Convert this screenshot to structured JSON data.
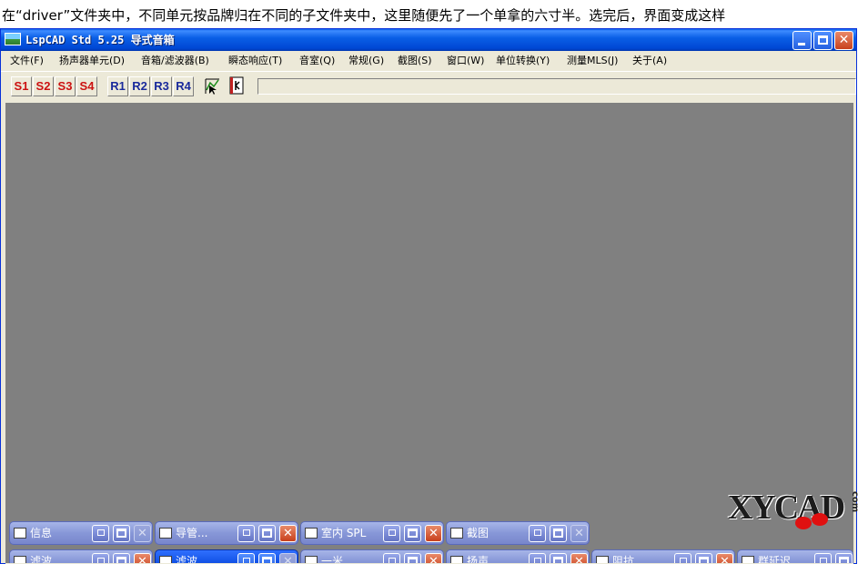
{
  "caption": "在“driver”文件夹中，不同单元按品牌归在不同的子文件夹中，这里随便先了一个单拿的六寸半。选完后，界面变成这样",
  "window": {
    "title": "LspCAD Std 5.25 导式音箱",
    "minimize_icon": "minimize-icon",
    "maximize_icon": "maximize-icon",
    "close_glyph": "✕"
  },
  "menu": [
    "文件(F)",
    "扬声器单元(D)",
    "音箱/滤波器(B)",
    "瞬态响应(T)",
    "音室(Q)",
    "常规(G)",
    "截图(S)",
    "窗口(W)",
    "单位转换(Y)",
    "测量MLS(J)",
    "关于(A)"
  ],
  "toolbar": {
    "s_buttons": [
      "S1",
      "S2",
      "S3",
      "S4"
    ],
    "r_buttons": [
      "R1",
      "R2",
      "R3",
      "R4"
    ]
  },
  "minimized_windows": [
    {
      "title": "信息",
      "close_enabled": false,
      "active": false
    },
    {
      "title": "导管...",
      "close_enabled": true,
      "active": false
    },
    {
      "title": "室内  SPL",
      "close_enabled": true,
      "active": false
    },
    {
      "title": "截图",
      "close_enabled": false,
      "active": false
    },
    {
      "title": "滤波...",
      "close_enabled": true,
      "active": false
    },
    {
      "title": "滤波...",
      "close_enabled": false,
      "active": true
    },
    {
      "title": "一米...",
      "close_enabled": true,
      "active": false
    },
    {
      "title": "扬声...",
      "close_enabled": true,
      "active": false
    },
    {
      "title": "阻抗",
      "close_enabled": true,
      "active": false
    },
    {
      "title": "群延迟",
      "close_enabled": true,
      "active": false
    }
  ],
  "watermark": {
    "text": "XYCAD",
    "side": "com"
  },
  "colors": {
    "titlebar": "#0a5fe6",
    "mdi_background": "#808080",
    "s_button_text": "#cc1111",
    "r_button_text": "#1a2a9c",
    "mini_active": "#1555e8",
    "mini_inactive": "#8797d8"
  }
}
